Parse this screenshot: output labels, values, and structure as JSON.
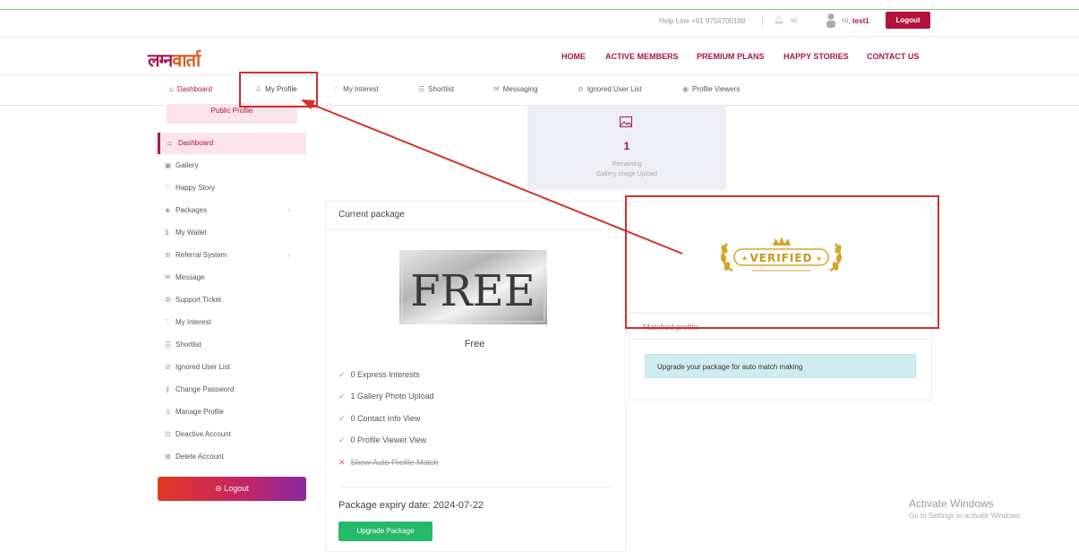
{
  "top_bar": {
    "helpline": "Help Line +91 9754700188",
    "greeting": "Hi,",
    "username": "test1",
    "logout": "Logout"
  },
  "logo": {
    "part1": "लग्न",
    "part2": "वार्ता"
  },
  "main_nav": [
    "HOME",
    "ACTIVE MEMBERS",
    "PREMIUM PLANS",
    "HAPPY STORIES",
    "CONTACT US"
  ],
  "sub_nav": [
    {
      "label": "Dashboard",
      "icon": "home-icon"
    },
    {
      "label": "My Profile",
      "icon": "user-icon"
    },
    {
      "label": "My Interest",
      "icon": "heart-icon"
    },
    {
      "label": "Shortlist",
      "icon": "list-icon"
    },
    {
      "label": "Messaging",
      "icon": "mail-icon"
    },
    {
      "label": "Ignored User List",
      "icon": "ban-icon"
    },
    {
      "label": "Profile Viewers",
      "icon": "eye-icon"
    }
  ],
  "sidebar": {
    "public_profile": "Public Profile",
    "items": [
      {
        "label": "Dashboard",
        "icon": "home-icon"
      },
      {
        "label": "Gallery",
        "icon": "image-icon"
      },
      {
        "label": "Happy Story",
        "icon": "heart-icon"
      },
      {
        "label": "Packages",
        "icon": "package-icon"
      },
      {
        "label": "My Wallet",
        "icon": "dollar-icon"
      },
      {
        "label": "Referral System",
        "icon": "share-icon"
      },
      {
        "label": "Message",
        "icon": "mail-icon"
      },
      {
        "label": "Support Ticket",
        "icon": "gear-icon"
      },
      {
        "label": "My Interest",
        "icon": "heart-icon"
      },
      {
        "label": "Shortlist",
        "icon": "list-icon"
      },
      {
        "label": "Ignored User List",
        "icon": "ban-icon"
      },
      {
        "label": "Change Password",
        "icon": "key-icon"
      },
      {
        "label": "Manage Profile",
        "icon": "user-icon"
      },
      {
        "label": "Deactive Account",
        "icon": "lock-icon"
      },
      {
        "label": "Delete Account",
        "icon": "trash-icon"
      }
    ],
    "logout": "Logout"
  },
  "gallery_stat": {
    "value": "1",
    "label_line1": "Remaining",
    "label_line2": "Gallery Image Upload"
  },
  "current_package": {
    "title": "Current package",
    "image_text": "FREE",
    "name": "Free",
    "features": [
      {
        "text": "0 Express Interests",
        "included": true
      },
      {
        "text": "1 Gallery Photo Upload",
        "included": true
      },
      {
        "text": "0 Contact Info View",
        "included": true
      },
      {
        "text": "0 Profile Viewer View",
        "included": true
      },
      {
        "text": "Show Auto Profile Match",
        "included": false
      }
    ],
    "expiry": "Package expiry date: 2024-07-22",
    "upgrade_button": "Upgrade Package"
  },
  "verified_badge": {
    "text": "VERIFIED"
  },
  "matched_profile": {
    "title": "Matched profile",
    "alert": "Upgrade your package for auto match making"
  },
  "windows_watermark": {
    "line1": "Activate Windows",
    "line2": "Go to Settings to activate Windows."
  },
  "colors": {
    "brand": "#a8164f",
    "annotation": "#d32f2f",
    "success": "#27b96a"
  }
}
